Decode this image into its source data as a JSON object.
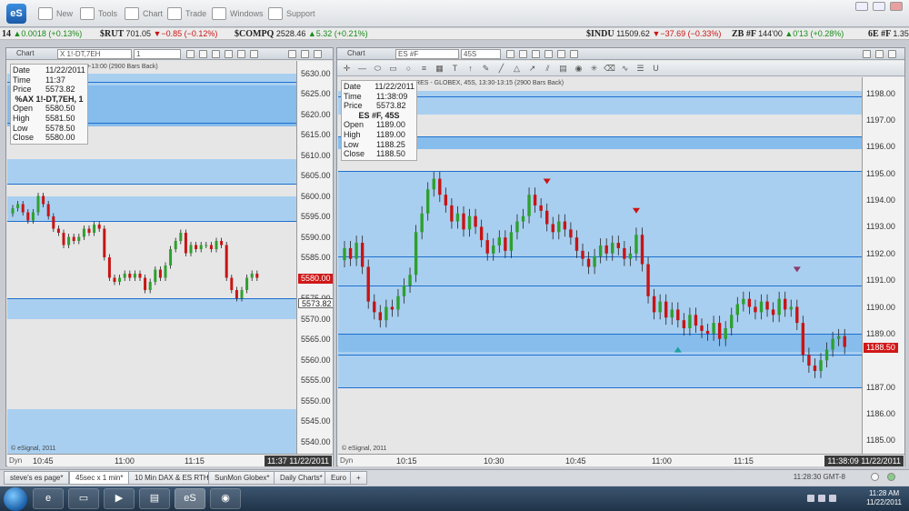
{
  "menu": {
    "new": "New",
    "tools": "Tools",
    "chart": "Chart",
    "trade": "Trade",
    "windows": "Windows",
    "support": "Support",
    "logo": "eS"
  },
  "ticker": [
    {
      "sym": "14",
      "val": "",
      "chg": "▲0.0018 (+0.13%)",
      "dir": "up"
    },
    {
      "sym": "$RUT",
      "val": "701.05",
      "chg": "▼−0.85 (−0.12%)",
      "dir": "dn"
    },
    {
      "sym": "$COMPQ",
      "val": "2528.46",
      "chg": "▲5.32 (+0.21%)",
      "dir": "up"
    },
    {
      "sym": "$INDU",
      "val": "11509.62",
      "chg": "▼−37.69 (−0.33%)",
      "dir": "dn"
    },
    {
      "sym": "ZB #F",
      "val": "144'00",
      "chg": "▲0'13 (+0.28%)",
      "dir": "up"
    },
    {
      "sym": "6E #F",
      "val": "1.35",
      "chg": "",
      "dir": "up"
    }
  ],
  "colors": {
    "up": "#2ea02e",
    "down": "#c81414",
    "band": "#a9cff0",
    "bandDark": "#86bdec",
    "line": "#1d6fd0"
  },
  "left": {
    "title": "Chart",
    "symbol": "X 1!-DT,7EH",
    "interval": "1",
    "header": "0-13:00 (2900 Bars Back)",
    "info": {
      "date_k": "Date",
      "date": "11/22/2011",
      "time_k": "Time",
      "time": "11:37",
      "price_k": "Price",
      "price": "5573.82",
      "name": "%AX 1!-DT,7EH, 1",
      "open_k": "Open",
      "open": "5580.50",
      "high_k": "High",
      "high": "5581.50",
      "low_k": "Low",
      "low": "5578.50",
      "close_k": "Close",
      "close": "5580.00"
    },
    "last_price": "5580.00",
    "cursor_price": "5573.82",
    "xlabels": [
      "10:45",
      "11:00",
      "11:15"
    ],
    "timestamp": "11:37 11/22/2011",
    "dyn": "Dyn",
    "copyright": "© eSignal, 2011",
    "ylabels": [
      "5630.00",
      "5625.00",
      "5620.00",
      "5615.00",
      "5610.00",
      "5605.00",
      "5600.00",
      "5595.00",
      "5590.00",
      "5585.00",
      "5575.00",
      "5570.00",
      "5565.00",
      "5560.00",
      "5555.00",
      "5550.00",
      "5545.00",
      "5540.00"
    ]
  },
  "right": {
    "title": "Chart",
    "symbol": "ES #F",
    "interval": "45S",
    "header": "URES - GLOBEX, 45S, 13:30-13:15 (2900 Bars Back)",
    "info": {
      "date_k": "Date",
      "date": "11/22/2011",
      "time_k": "Time",
      "time": "11:38:09",
      "price_k": "Price",
      "price": "5573.82",
      "name": "ES #F, 45S",
      "open_k": "Open",
      "open": "1189.00",
      "high_k": "High",
      "high": "1189.00",
      "low_k": "Low",
      "low": "1188.25",
      "close_k": "Close",
      "close": "1188.50"
    },
    "last_price": "1188.50",
    "xlabels": [
      "10:15",
      "10:30",
      "10:45",
      "11:00",
      "11:15"
    ],
    "timestamp": "11:38:09 11/22/2011",
    "dyn": "Dyn",
    "copyright": "© eSignal, 2011",
    "ylabels": [
      "1198.00",
      "1197.00",
      "1196.00",
      "1195.00",
      "1194.00",
      "1193.00",
      "1192.00",
      "1191.00",
      "1190.00",
      "1189.00",
      "1187.00",
      "1186.00",
      "1185.00"
    ]
  },
  "tabs": [
    "steve's es page*",
    "45sec x 1 min*",
    "10 Min DAX & ES RTH*",
    "SunMon Globex*",
    "Daily Charts*",
    "Euro",
    "+"
  ],
  "status_time": "11:28:30 GMT-8",
  "clock": {
    "time": "11:28 AM",
    "date": "11/22/2011"
  },
  "taskbar_es": "eS",
  "chart_data": [
    {
      "type": "candlestick",
      "title": "%AX 1!-DT,7EH, 1",
      "ylim": [
        5537,
        5633
      ],
      "x_ticks": [
        "10:45",
        "11:00",
        "11:15"
      ],
      "series": [
        {
          "name": "%AX 1!-DT,7EH",
          "close": [
            5597,
            5598,
            5596,
            5594,
            5596,
            5600,
            5598,
            5595,
            5592,
            5591,
            5588,
            5590,
            5589,
            5590,
            5592,
            5591,
            5593,
            5592,
            5585,
            5580,
            5579,
            5580,
            5581,
            5580,
            5581,
            5580,
            5577,
            5579,
            5582,
            5580,
            5583,
            5587,
            5589,
            5591,
            5586,
            5588,
            5587,
            5588,
            5588,
            5587,
            5589,
            5588,
            5580,
            5577,
            5575,
            5577,
            5580,
            5581,
            5580
          ]
        }
      ]
    },
    {
      "type": "candlestick",
      "title": "ES #F, 45S",
      "ylim": [
        1184.5,
        1198.6
      ],
      "x_ticks": [
        "10:15",
        "10:30",
        "10:45",
        "11:00",
        "11:15"
      ],
      "series": [
        {
          "name": "ES #F",
          "close": [
            1192.2,
            1191.8,
            1192.4,
            1191.5,
            1190.2,
            1189.8,
            1189.5,
            1190.0,
            1189.9,
            1190.4,
            1190.8,
            1191.2,
            1192.8,
            1193.5,
            1194.4,
            1194.8,
            1194.2,
            1193.8,
            1193.2,
            1193.5,
            1192.9,
            1193.4,
            1193.0,
            1192.5,
            1192.0,
            1192.3,
            1192.6,
            1192.1,
            1192.8,
            1193.2,
            1193.4,
            1194.2,
            1193.8,
            1193.6,
            1193.1,
            1192.8,
            1193.2,
            1192.9,
            1192.6,
            1192.1,
            1191.8,
            1191.5,
            1191.9,
            1192.3,
            1192.0,
            1192.4,
            1192.2,
            1191.8,
            1192.0,
            1192.7,
            1191.6,
            1190.4,
            1189.8,
            1190.2,
            1189.6,
            1189.9,
            1189.5,
            1189.2,
            1189.7,
            1189.3,
            1189.1,
            1189.0,
            1189.4,
            1188.8,
            1189.2,
            1189.7,
            1190.1,
            1190.3,
            1190.0,
            1189.8,
            1190.2,
            1189.9,
            1189.7,
            1190.3,
            1189.9,
            1190.0,
            1189.4,
            1188.2,
            1187.8,
            1187.6,
            1188.0,
            1188.4,
            1188.8,
            1188.9,
            1188.5
          ]
        }
      ]
    }
  ]
}
